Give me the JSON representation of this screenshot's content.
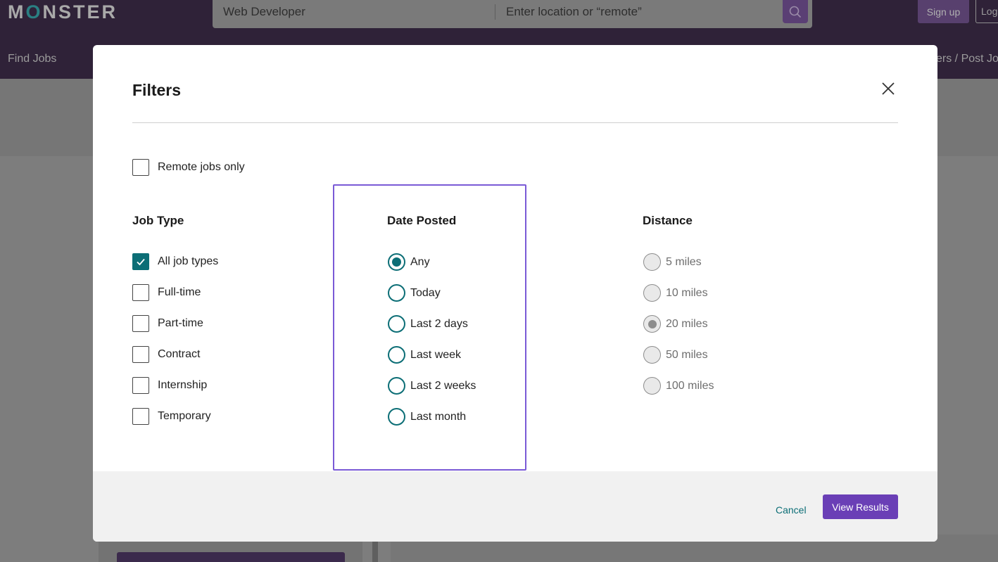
{
  "header": {
    "logo_prefix": "M",
    "logo_o": "O",
    "logo_suffix": "NSTER",
    "search_value": "Web Developer",
    "location_placeholder": "Enter location or “remote”",
    "signup_label": "Sign up",
    "login_label": "Log",
    "nav_find_jobs": "Find Jobs",
    "nav_employers": "ers / Post Jobs"
  },
  "modal": {
    "title": "Filters",
    "remote_label": "Remote jobs only",
    "remote_checked": false,
    "job_type": {
      "heading": "Job Type",
      "options": [
        {
          "label": "All job types",
          "checked": true
        },
        {
          "label": "Full-time",
          "checked": false
        },
        {
          "label": "Part-time",
          "checked": false
        },
        {
          "label": "Contract",
          "checked": false
        },
        {
          "label": "Internship",
          "checked": false
        },
        {
          "label": "Temporary",
          "checked": false
        }
      ]
    },
    "date_posted": {
      "heading": "Date Posted",
      "selected": "Any",
      "options": [
        {
          "label": "Any"
        },
        {
          "label": "Today"
        },
        {
          "label": "Last 2 days"
        },
        {
          "label": "Last week"
        },
        {
          "label": "Last 2 weeks"
        },
        {
          "label": "Last month"
        }
      ]
    },
    "distance": {
      "heading": "Distance",
      "selected": "20 miles",
      "options": [
        {
          "label": "5 miles"
        },
        {
          "label": "10 miles"
        },
        {
          "label": "20 miles"
        },
        {
          "label": "50 miles"
        },
        {
          "label": "100 miles"
        }
      ]
    },
    "footer": {
      "cancel_label": "Cancel",
      "view_results_label": "View Results"
    }
  },
  "colors": {
    "accent_teal": "#0c6e76",
    "brand_purple": "#6a3fb6",
    "focus_outline": "#7a5ad6",
    "header_bg": "#2f2238"
  }
}
